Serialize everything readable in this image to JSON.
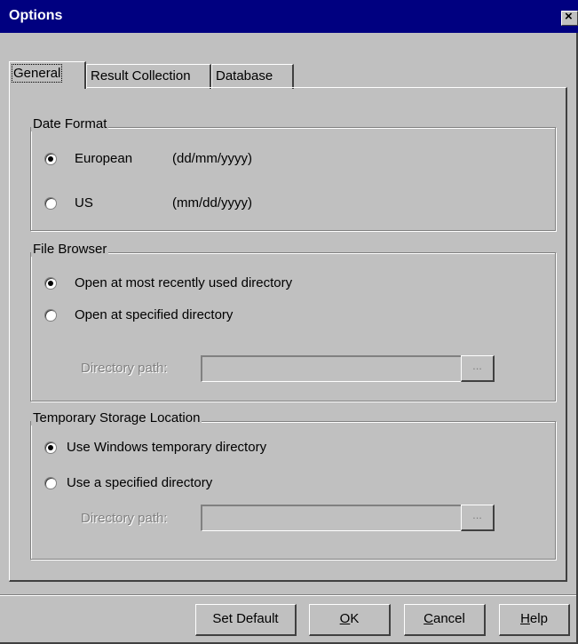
{
  "window": {
    "title": "Options",
    "close_glyph": "×"
  },
  "tabs": [
    {
      "label": "General",
      "active": true
    },
    {
      "label": "Result Collection",
      "active": false
    },
    {
      "label": "Database",
      "active": false
    }
  ],
  "date_format": {
    "legend": "Date Format",
    "options": [
      {
        "label": "European",
        "hint": "(dd/mm/yyyy)",
        "selected": true
      },
      {
        "label": "US",
        "hint": "(mm/dd/yyyy)",
        "selected": false
      }
    ]
  },
  "file_browser": {
    "legend": "File Browser",
    "options": [
      {
        "label": "Open at most recently used directory",
        "selected": true
      },
      {
        "label": "Open at specified directory",
        "selected": false
      }
    ],
    "path_label": "Directory  path:",
    "path_value": "",
    "browse_label": "..."
  },
  "temp_storage": {
    "legend": "Temporary Storage Location",
    "options": [
      {
        "label": "Use Windows temporary directory",
        "selected": true
      },
      {
        "label": "Use a specified directory",
        "selected": false
      }
    ],
    "path_label": "Directory  path:",
    "path_value": "",
    "browse_label": "..."
  },
  "buttons": {
    "set_default": "Set Default",
    "ok_mnemonic": "O",
    "ok_rest": "K",
    "cancel_mnemonic": "C",
    "cancel_rest": "ancel",
    "help_mnemonic": "H",
    "help_rest": "elp"
  },
  "colors": {
    "titlebar": "#000080",
    "face": "#c0c0c0",
    "disabled_text": "#808080"
  }
}
